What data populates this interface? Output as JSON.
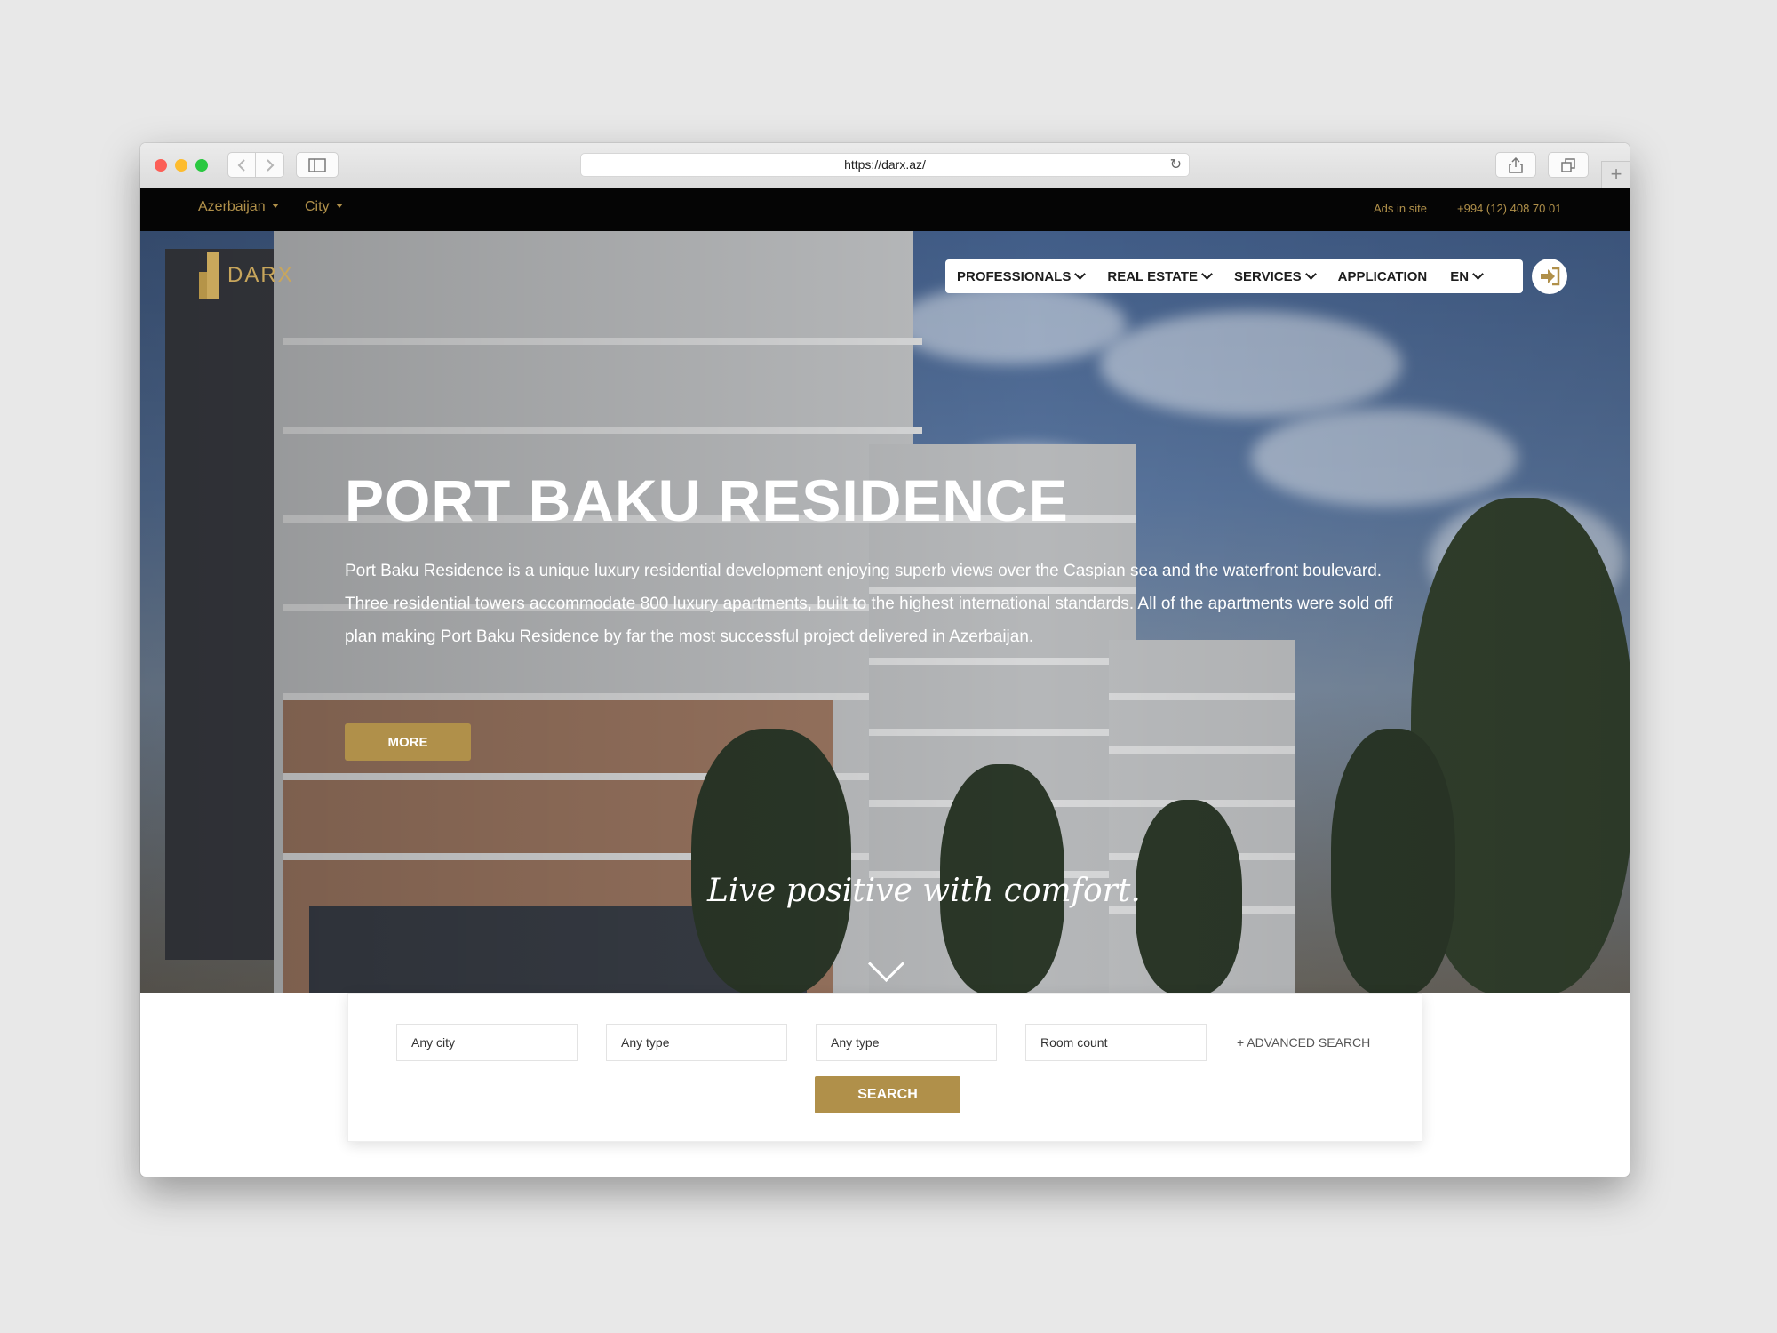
{
  "browser": {
    "url": "https://darx.az/"
  },
  "topbar": {
    "country": "Azerbaijan",
    "city": "City",
    "ads_link": "Ads in site",
    "phone": "+994 (12) 408 70 01"
  },
  "brand": {
    "logo_text": "DARX",
    "accent_color": "#b0904a"
  },
  "nav": {
    "items": [
      {
        "label": "PROFESSIONALS",
        "dropdown": true
      },
      {
        "label": "REAL ESTATE",
        "dropdown": true
      },
      {
        "label": "SERVICES",
        "dropdown": true
      },
      {
        "label": "APPLICATION",
        "dropdown": false
      }
    ],
    "language": "EN",
    "login_icon": "sign-in-icon"
  },
  "hero": {
    "title": "PORT BAKU RESIDENCE",
    "description": "Port Baku Residence is a unique luxury residential development enjoying superb views over the Caspian sea and the waterfront boulevard. Three residential towers accommodate 800 luxury apartments, built to the highest international standards. All of the apartments were sold off plan making Port Baku Residence by far the most successful project delivered in Azerbaijan.",
    "more_button": "MORE",
    "slogan": "Live positive with comfort."
  },
  "search": {
    "city_placeholder": "Any city",
    "type1_placeholder": "Any type",
    "type2_placeholder": "Any type",
    "rooms_placeholder": "Room count",
    "advanced_link": "+ ADVANCED SEARCH",
    "search_button": "SEARCH"
  }
}
